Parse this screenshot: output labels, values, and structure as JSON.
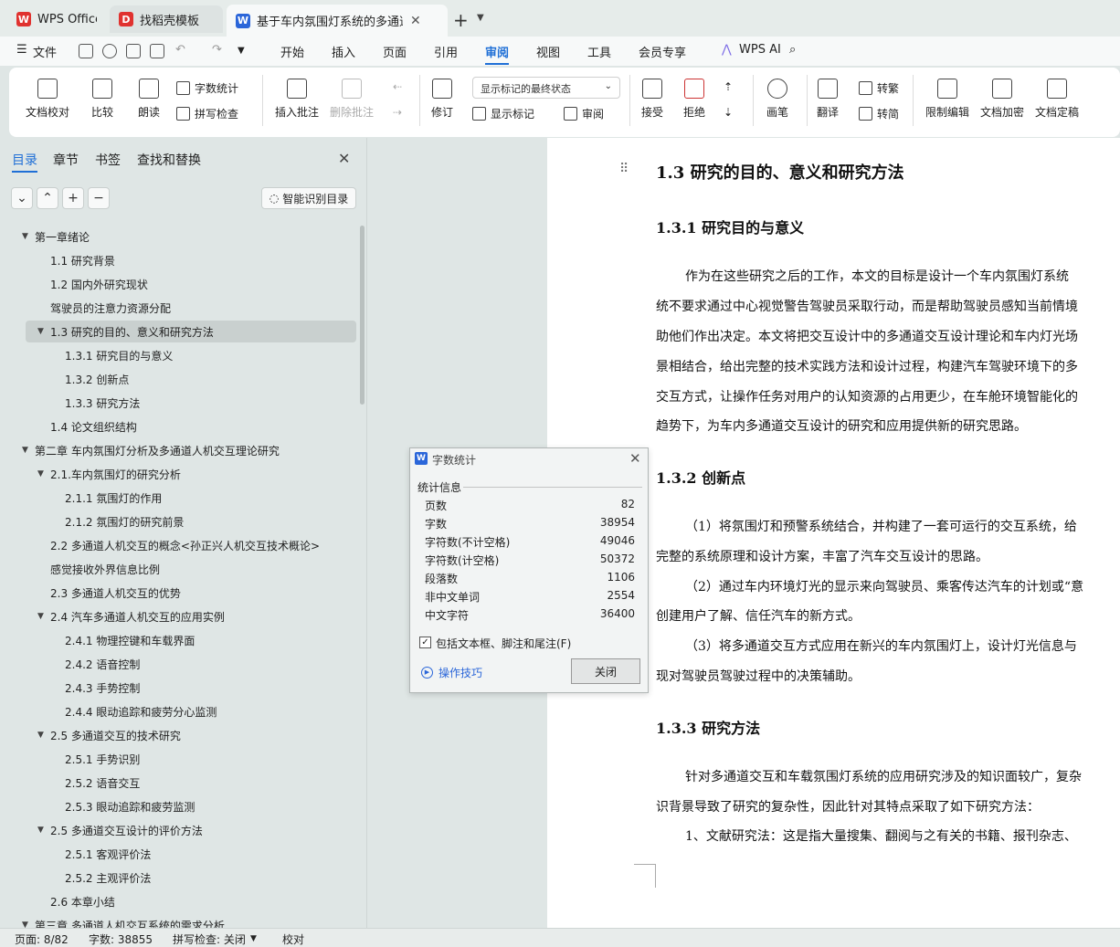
{
  "tabs": [
    {
      "label": "WPS Office",
      "color": "#e0322f",
      "glyph": "W"
    },
    {
      "label": "找稻壳模板",
      "color": "#e0322f",
      "glyph": "D"
    },
    {
      "label": "基于车内氛围灯系统的多通道人机交互设计研究",
      "color": "#2b66d9",
      "glyph": "W"
    }
  ],
  "menubar": {
    "file": "文件",
    "items": [
      "开始",
      "插入",
      "页面",
      "引用",
      "审阅",
      "视图",
      "工具",
      "会员专享"
    ],
    "active": "审阅",
    "ai": "WPS AI"
  },
  "ribbon": {
    "proofread": "文档校对",
    "compare": "比较",
    "read_aloud": "朗读",
    "word_count": "字数统计",
    "spell_check": "拼写检查",
    "insert_comment": "插入批注",
    "delete_comment": "删除批注",
    "track": "修订",
    "markup_mode": "显示标记的最终状态",
    "show_markup": "显示标记",
    "review_pane": "审阅",
    "accept": "接受",
    "reject": "拒绝",
    "pen": "画笔",
    "translate": "翻译",
    "to_traditional": "转繁",
    "to_simplified": "转简",
    "restrict": "限制编辑",
    "encrypt": "文档加密",
    "finalize": "文档定稿"
  },
  "nav": {
    "tabs": [
      "目录",
      "章节",
      "书签",
      "查找和替换"
    ],
    "smart_toc": "智能识别目录",
    "items": [
      {
        "text": "第一章绪论",
        "level": 0,
        "arrow": true
      },
      {
        "text": "1.1 研究背景",
        "level": 1
      },
      {
        "text": "1.2 国内外研究现状",
        "level": 1
      },
      {
        "text": "驾驶员的注意力资源分配",
        "level": 1
      },
      {
        "text": "1.3 研究的目的、意义和研究方法",
        "level": 1,
        "arrow": true,
        "selected": true
      },
      {
        "text": "1.3.1 研究目的与意义",
        "level": 2
      },
      {
        "text": "1.3.2 创新点",
        "level": 2
      },
      {
        "text": "1.3.3 研究方法",
        "level": 2
      },
      {
        "text": "1.4 论文组织结构",
        "level": 1
      },
      {
        "text": "第二章  车内氛围灯分析及多通道人机交互理论研究",
        "level": 0,
        "arrow": true
      },
      {
        "text": "2.1.车内氛围灯的研究分析",
        "level": 1,
        "arrow": true
      },
      {
        "text": "2.1.1 氛围灯的作用",
        "level": 2
      },
      {
        "text": "2.1.2 氛围灯的研究前景",
        "level": 2
      },
      {
        "text": "2.2  多通道人机交互的概念<孙正兴人机交互技术概论>",
        "level": 1
      },
      {
        "text": "感觉接收外界信息比例",
        "level": 1
      },
      {
        "text": "2.3 多通道人机交互的优势",
        "level": 1
      },
      {
        "text": "2.4 汽车多通道人机交互的应用实例",
        "level": 1,
        "arrow": true
      },
      {
        "text": "2.4.1 物理控键和车载界面",
        "level": 2
      },
      {
        "text": "2.4.2 语音控制",
        "level": 2
      },
      {
        "text": "2.4.3 手势控制",
        "level": 2
      },
      {
        "text": "2.4.4 眼动追踪和疲劳分心监测",
        "level": 2
      },
      {
        "text": "2.5 多通道交互的技术研究",
        "level": 1,
        "arrow": true
      },
      {
        "text": "2.5.1 手势识别",
        "level": 2
      },
      {
        "text": "2.5.2 语音交互",
        "level": 2
      },
      {
        "text": "2.5.3 眼动追踪和疲劳监测",
        "level": 2
      },
      {
        "text": "2.5 多通道交互设计的评价方法",
        "level": 1,
        "arrow": true
      },
      {
        "text": "2.5.1 客观评价法",
        "level": 2
      },
      {
        "text": "2.5.2 主观评价法",
        "level": 2
      },
      {
        "text": "2.6 本章小结",
        "level": 1
      },
      {
        "text": "第三章  多通道人机交互系统的需求分析",
        "level": 0,
        "arrow": true
      }
    ]
  },
  "doc": {
    "h_main": "1.3 研究的目的、意义和研究方法",
    "h1": "1.3.1 研究目的与意义",
    "p1": [
      "作为在这些研究之后的工作，本文的目标是设计一个车内氛围灯系统",
      "统不要求通过中心视觉警告驾驶员采取行动，而是帮助驾驶员感知当前情境",
      "助他们作出决定。本文将把交互设计中的多通道交互设计理论和车内灯光场",
      "景相结合，给出完整的技术实践方法和设计过程，构建汽车驾驶环境下的多",
      "交互方式，让操作任务对用户的认知资源的占用更少，在车舱环境智能化的",
      "趋势下，为车内多通道交互设计的研究和应用提供新的研究思路。"
    ],
    "h2": "1.3.2 创新点",
    "p2": [
      "（1）将氛围灯和预警系统结合，并构建了一套可运行的交互系统，给",
      "完整的系统原理和设计方案，丰富了汽车交互设计的思路。",
      "（2）通过车内环境灯光的显示来向驾驶员、乘客传达汽车的计划或“意",
      "创建用户了解、信任汽车的新方式。",
      "（3）将多通道交互方式应用在新兴的车内氛围灯上，设计灯光信息与",
      "现对驾驶员驾驶过程中的决策辅助。"
    ],
    "h3": "1.3.3 研究方法",
    "p3": [
      "针对多通道交互和车载氛围灯系统的应用研究涉及的知识面较广，复杂",
      "识背景导致了研究的复杂性，因此针对其特点采取了如下研究方法：",
      "1、文献研究法：这是指大量搜集、翻阅与之有关的书籍、报刊杂志、"
    ]
  },
  "dialog": {
    "title": "字数统计",
    "group": "统计信息",
    "stats": [
      {
        "k": "页数",
        "v": "82"
      },
      {
        "k": "字数",
        "v": "38954"
      },
      {
        "k": "字符数(不计空格)",
        "v": "49046"
      },
      {
        "k": "字符数(计空格)",
        "v": "50372"
      },
      {
        "k": "段落数",
        "v": "1106"
      },
      {
        "k": "非中文单词",
        "v": "2554"
      },
      {
        "k": "中文字符",
        "v": "36400"
      }
    ],
    "checkbox": "包括文本框、脚注和尾注(F)",
    "checked": true,
    "tips": "操作技巧",
    "close": "关闭"
  },
  "status": {
    "page": "页面: 8/82",
    "words": "字数: 38855",
    "spell": "拼写检查: 关闭",
    "proof": "校对"
  }
}
